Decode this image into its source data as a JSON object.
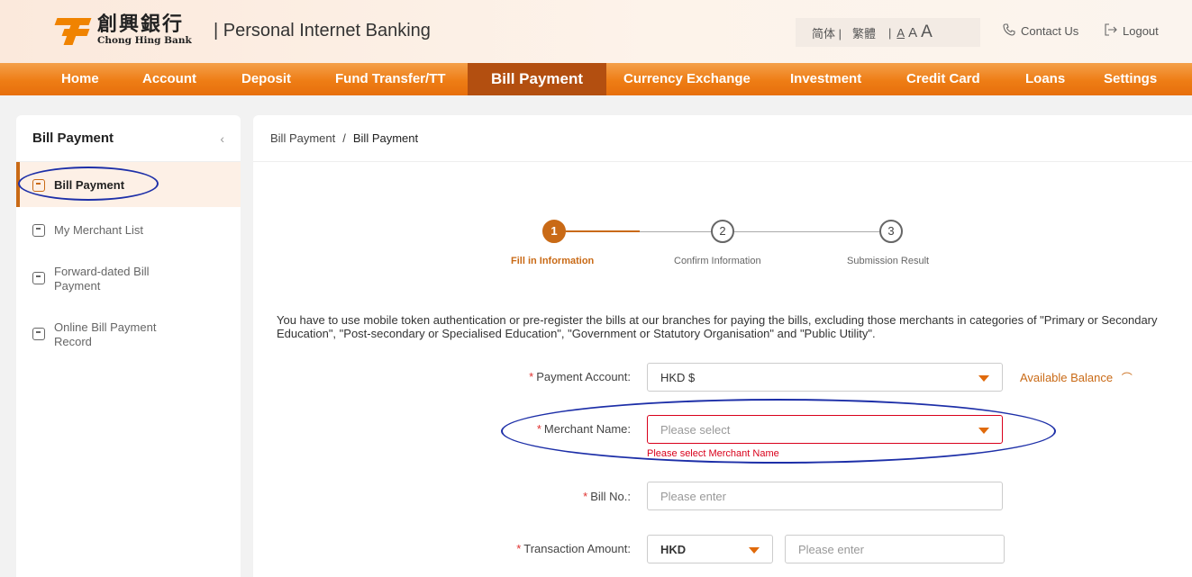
{
  "header": {
    "logo_cn": "創興銀行",
    "logo_en": "Chong Hing Bank",
    "portal_title": "| Personal Internet Banking",
    "lang_simplified": "简体 |",
    "lang_traditional": "繁體",
    "font_sep": "|",
    "font_small": "A",
    "font_medium": "A",
    "font_large": "A",
    "contact_label": "Contact Us",
    "logout_label": "Logout"
  },
  "nav": {
    "items": [
      "Home",
      "Account",
      "Deposit",
      "Fund Transfer/TT",
      "Bill Payment",
      "Currency Exchange",
      "Investment",
      "Credit Card",
      "Loans",
      "Settings"
    ],
    "active": "Bill Payment"
  },
  "sidebar": {
    "title": "Bill Payment",
    "items": [
      {
        "label": "Bill Payment",
        "active": true
      },
      {
        "label": "My Merchant List",
        "active": false
      },
      {
        "label": "Forward-dated Bill Payment",
        "active": false
      },
      {
        "label": "Online Bill Payment Record",
        "active": false
      }
    ]
  },
  "breadcrumb": {
    "parent": "Bill Payment",
    "separator": "/",
    "current": "Bill Payment"
  },
  "stepper": {
    "steps": [
      {
        "number": "1",
        "label": "Fill in Information",
        "active": true
      },
      {
        "number": "2",
        "label": "Confirm Information",
        "active": false
      },
      {
        "number": "3",
        "label": "Submission Result",
        "active": false
      }
    ]
  },
  "notice": "You have to use mobile token authentication or pre-register the bills at our branches for paying the bills, excluding those merchants in categories of \"Primary or Secondary Education\", \"Post-secondary or Specialised Education\", \"Government or Statutory Organisation\" and \"Public Utility\".",
  "form": {
    "payment_account": {
      "label": "Payment Account:",
      "value": "HKD $",
      "required_mark": "*"
    },
    "available_balance": "Available Balance",
    "merchant_name": {
      "label": "Merchant Name:",
      "placeholder": "Please select",
      "error": "Please select Merchant Name",
      "required_mark": "*"
    },
    "bill_no": {
      "label": "Bill No.:",
      "placeholder": "Please enter",
      "required_mark": "*"
    },
    "transaction_amount": {
      "label": "Transaction Amount:",
      "currency": "HKD",
      "placeholder": "Please enter",
      "required_mark": "*"
    }
  },
  "colors": {
    "brand_orange": "#ee7d15",
    "nav_active": "#b34f10",
    "accent": "#c96a16",
    "error": "#d9001b",
    "annotation": "#1d2fa8"
  }
}
